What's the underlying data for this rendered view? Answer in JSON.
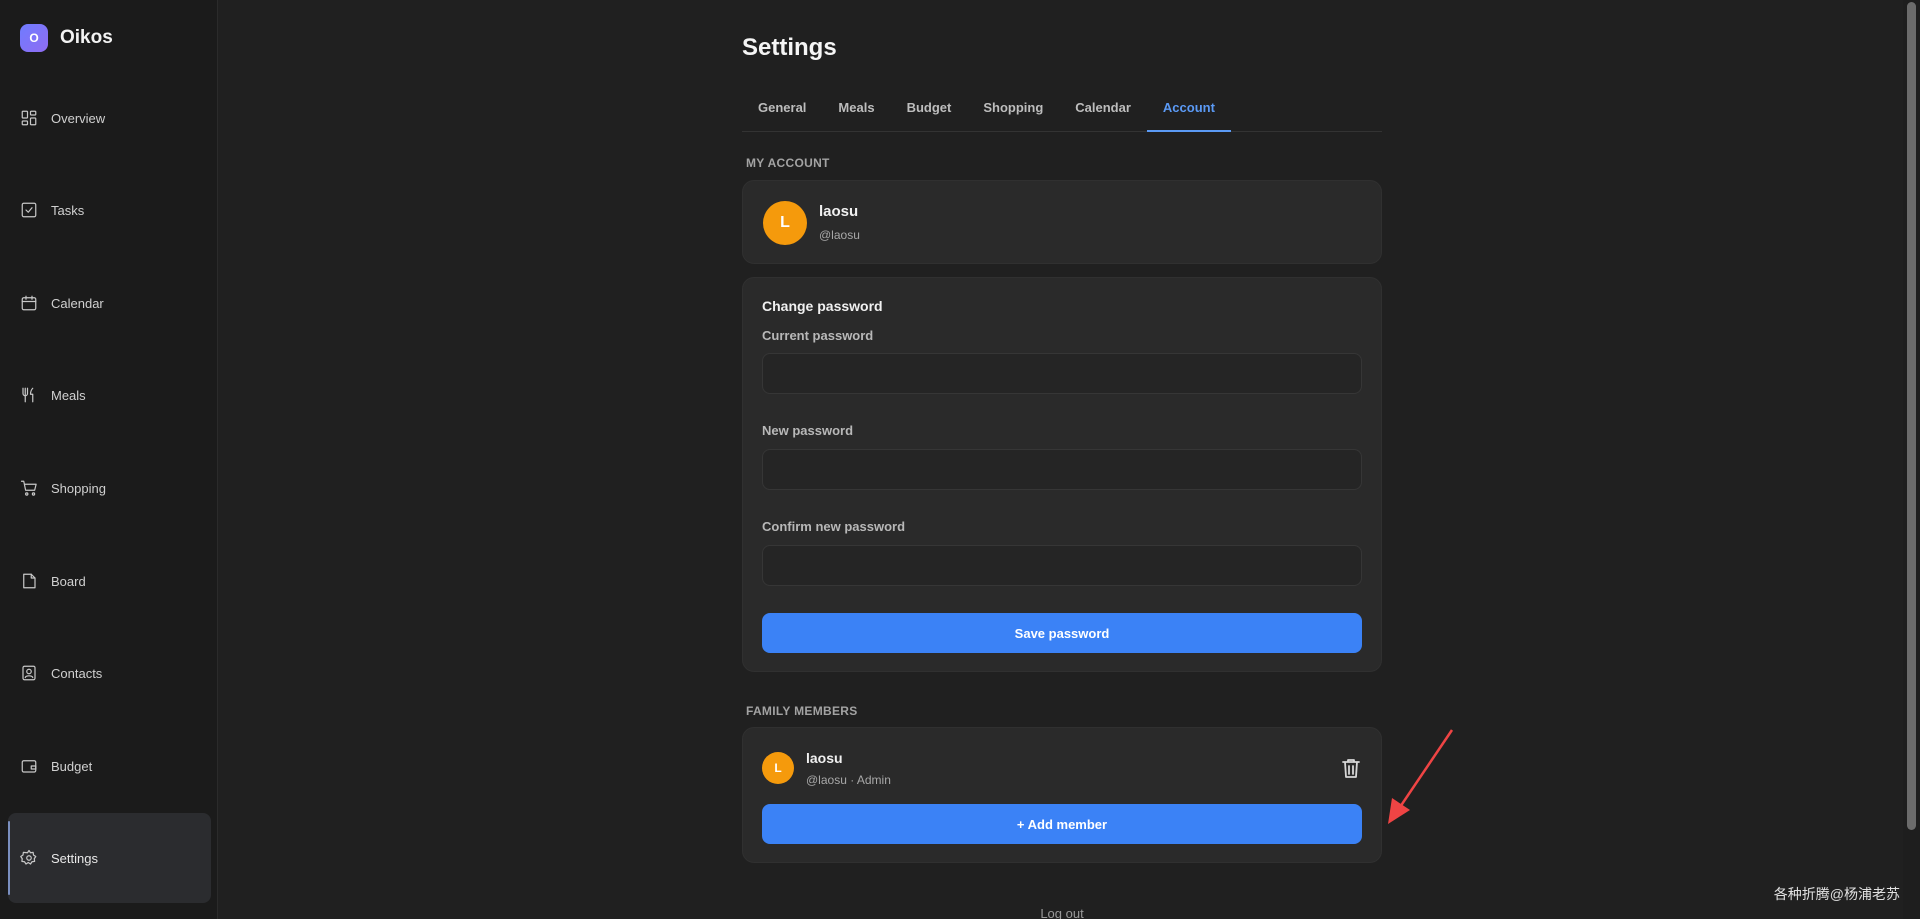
{
  "brand": {
    "logo_letter": "O",
    "name": "Oikos"
  },
  "sidebar": {
    "items": [
      {
        "label": "Overview",
        "icon": "grid-icon"
      },
      {
        "label": "Tasks",
        "icon": "checkbox-icon"
      },
      {
        "label": "Calendar",
        "icon": "calendar-icon"
      },
      {
        "label": "Meals",
        "icon": "utensils-icon"
      },
      {
        "label": "Shopping",
        "icon": "cart-icon"
      },
      {
        "label": "Board",
        "icon": "note-icon"
      },
      {
        "label": "Contacts",
        "icon": "contact-icon"
      },
      {
        "label": "Budget",
        "icon": "wallet-icon"
      },
      {
        "label": "Settings",
        "icon": "gear-icon",
        "active": true
      }
    ]
  },
  "page": {
    "title": "Settings"
  },
  "tabs": [
    {
      "label": "General"
    },
    {
      "label": "Meals"
    },
    {
      "label": "Budget"
    },
    {
      "label": "Shopping"
    },
    {
      "label": "Calendar"
    },
    {
      "label": "Account",
      "active": true
    }
  ],
  "account": {
    "section_label": "MY ACCOUNT",
    "avatar_letter": "L",
    "name": "laosu",
    "handle": "@laosu"
  },
  "password": {
    "title": "Change password",
    "current_label": "Current password",
    "current_value": "",
    "new_label": "New password",
    "new_value": "",
    "confirm_label": "Confirm new password",
    "confirm_value": "",
    "save_label": "Save password"
  },
  "family": {
    "section_label": "FAMILY MEMBERS",
    "members": [
      {
        "avatar_letter": "L",
        "name": "laosu",
        "meta": "@laosu · Admin"
      }
    ],
    "add_label": "+ Add member"
  },
  "logout_label": "Log out",
  "watermark": "各种折腾@杨浦老苏",
  "colors": {
    "accent": "#3b82f6",
    "tab_active": "#5b9af5",
    "avatar": "#f59a0c",
    "annotation_arrow": "#ef4444"
  }
}
